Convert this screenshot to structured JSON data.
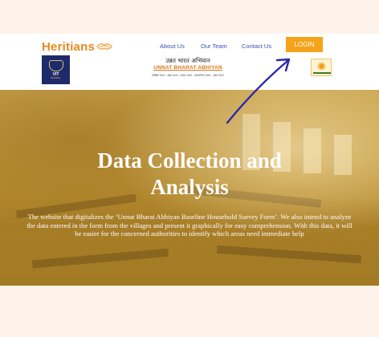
{
  "brand": {
    "name_part1": "Her",
    "name_part2": "itians"
  },
  "nav": {
    "about": "About Us",
    "team": "Our Team",
    "contact": "Contact Us",
    "login": "LOGIN"
  },
  "header": {
    "vit_logo_text": "VIT",
    "vit_logo_subtext": "BHOPAL",
    "uba_hindi": "उन्नत भारत अभियान",
    "uba_english": "UNNAT BHARAT ABHIYAN",
    "uba_tagline": "शिक्षित भारत - उन्नत भारत - स्वस्थ भारत - आत्मनिर्भर भारत - उन्नत भारत"
  },
  "hero": {
    "title": "Data Collection and Analysis",
    "description": "The website that digitalizes the ‘Unnat Bharat Abhiyan Baseline Household Survey Form’. We also intend to analyze the data entered in the form from the villages and present it graphically for easy comprehension. With this data, it will be easier for the concerned authorities to identify which areas need immediate help"
  },
  "colors": {
    "brand_orange": "#e58a1f",
    "nav_blue": "#3a4fb8",
    "login_bg": "#f5a31a",
    "page_bg": "#fdf3ea",
    "hero_tint": "#c09a3e",
    "annotation_arrow": "#2b2aa8"
  },
  "icons": {
    "brand": "handshake-icon",
    "annotation": "arrow-annotation-icon"
  }
}
